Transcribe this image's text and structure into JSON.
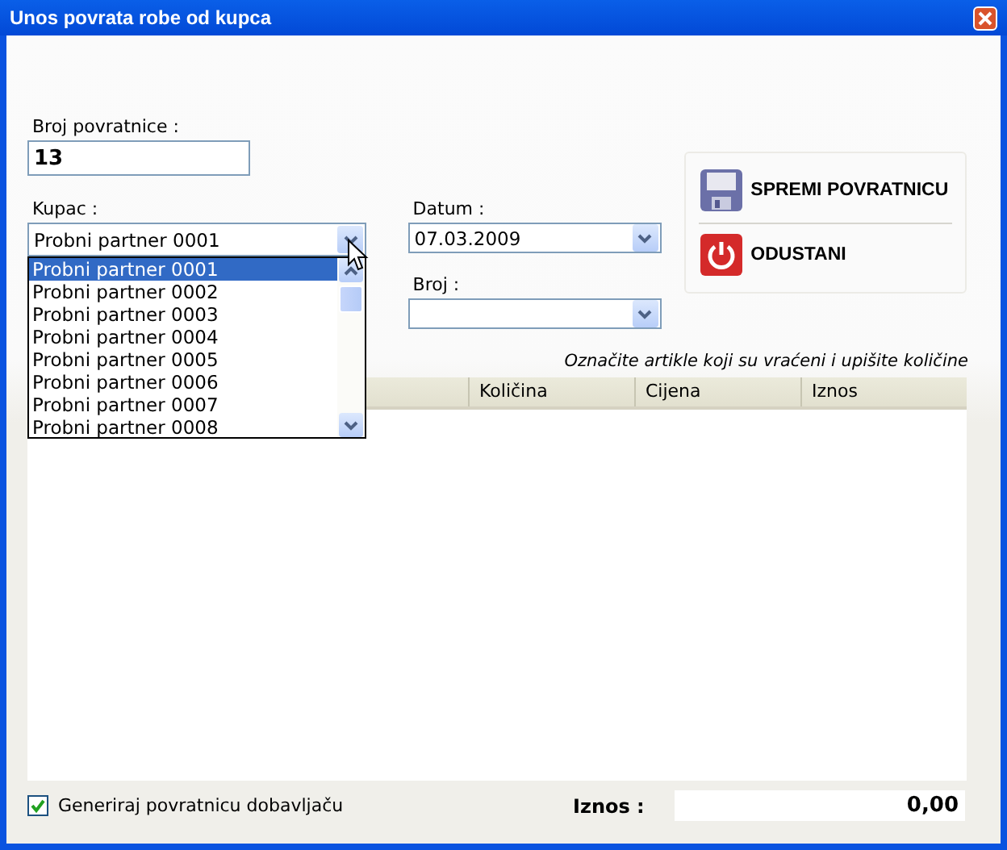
{
  "window": {
    "title": "Unos povrata robe od kupca"
  },
  "form": {
    "broj_povratnice": {
      "label": "Broj povratnice :",
      "value": "13"
    },
    "kupac": {
      "label": "Kupac :",
      "value": "Probni partner 0001",
      "expanded": true,
      "options": [
        {
          "label": "Probni partner 0001",
          "selected": true
        },
        {
          "label": "Probni partner 0002",
          "selected": false
        },
        {
          "label": "Probni partner 0003",
          "selected": false
        },
        {
          "label": "Probni partner 0004",
          "selected": false
        },
        {
          "label": "Probni partner 0005",
          "selected": false
        },
        {
          "label": "Probni partner 0006",
          "selected": false
        },
        {
          "label": "Probni partner 0007",
          "selected": false
        },
        {
          "label": "Probni partner 0008",
          "selected": false
        }
      ]
    },
    "datum": {
      "label": "Datum :",
      "value": "07.03.2009"
    },
    "broj": {
      "label": "Broj :"
    }
  },
  "actions": [
    {
      "label": "SPREMI POVRATNICU",
      "kind": "save"
    },
    {
      "label": "ODUSTANI",
      "kind": "cancel"
    }
  ],
  "hint": "Označite artikle koji su vraćeni i upišite količine",
  "table": {
    "columns": [
      "Količina",
      "Cijena",
      "Iznos"
    ]
  },
  "footer": {
    "checkbox": {
      "label": "Generiraj povratnicu dobavljaču",
      "checked": true
    },
    "total_label": "Iznos :",
    "total_value": "0,00"
  }
}
